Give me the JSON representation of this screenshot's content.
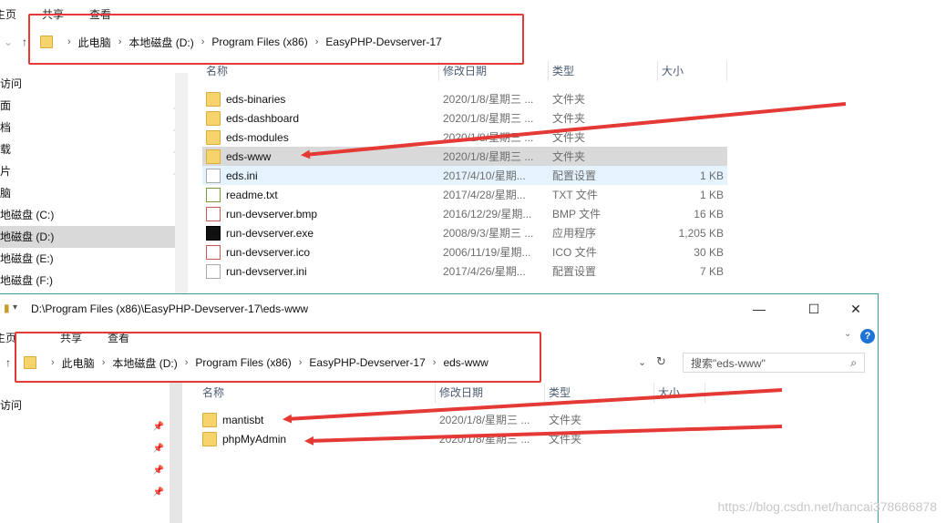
{
  "top": {
    "ribbon": [
      "主页",
      "共享",
      "查看"
    ],
    "breadcrumb": [
      "此电脑",
      "本地磁盘 (D:)",
      "Program Files (x86)",
      "EasyPHP-Devserver-17"
    ],
    "sidebar": [
      "访问",
      "面",
      "档",
      "载",
      "片",
      "脑",
      "地磁盘 (C:)",
      "地磁盘 (D:)",
      "地磁盘 (E:)",
      "地磁盘 (F:)"
    ],
    "columns": {
      "name": "名称",
      "date": "修改日期",
      "type": "类型",
      "size": "大小"
    },
    "files": [
      {
        "name": "eds-binaries",
        "date": "2020/1/8/星期三 ...",
        "type": "文件夹",
        "size": "",
        "icon": "folder-icon"
      },
      {
        "name": "eds-dashboard",
        "date": "2020/1/8/星期三 ...",
        "type": "文件夹",
        "size": "",
        "icon": "folder-icon"
      },
      {
        "name": "eds-modules",
        "date": "2020/1/8/星期三 ...",
        "type": "文件夹",
        "size": "",
        "icon": "folder-icon"
      },
      {
        "name": "eds-www",
        "date": "2020/1/8/星期三 ...",
        "type": "文件夹",
        "size": "",
        "icon": "folder-icon"
      },
      {
        "name": "eds.ini",
        "date": "2017/4/10/星期...",
        "type": "配置设置",
        "size": "1 KB",
        "icon": "ini-file-icon"
      },
      {
        "name": "readme.txt",
        "date": "2017/4/28/星期...",
        "type": "TXT 文件",
        "size": "1 KB",
        "icon": "txt-file-icon"
      },
      {
        "name": "run-devserver.bmp",
        "date": "2016/12/29/星期...",
        "type": "BMP 文件",
        "size": "16 KB",
        "icon": "bmp-file-icon"
      },
      {
        "name": "run-devserver.exe",
        "date": "2008/9/3/星期三 ...",
        "type": "应用程序",
        "size": "1,205 KB",
        "icon": "exe-file-icon"
      },
      {
        "name": "run-devserver.ico",
        "date": "2006/11/19/星期...",
        "type": "ICO 文件",
        "size": "30 KB",
        "icon": "ico-file-icon"
      },
      {
        "name": "run-devserver.ini",
        "date": "2017/4/26/星期...",
        "type": "配置设置",
        "size": "7 KB",
        "icon": "ini-file-icon"
      }
    ]
  },
  "bottom": {
    "title": "D:\\Program Files (x86)\\EasyPHP-Devserver-17\\eds-www",
    "ribbon": [
      "主页",
      "共享",
      "查看"
    ],
    "breadcrumb": [
      "此电脑",
      "本地磁盘 (D:)",
      "Program Files (x86)",
      "EasyPHP-Devserver-17",
      "eds-www"
    ],
    "search_placeholder": "搜索\"eds-www\"",
    "sidebar": [
      "访问"
    ],
    "columns": {
      "name": "名称",
      "date": "修改日期",
      "type": "类型",
      "size": "大小"
    },
    "files": [
      {
        "name": "mantisbt",
        "date": "2020/1/8/星期三 ...",
        "type": "文件夹",
        "icon": "folder-icon"
      },
      {
        "name": "phpMyAdmin",
        "date": "2020/1/8/星期三 ...",
        "type": "文件夹",
        "icon": "folder-icon"
      }
    ]
  },
  "watermark": "https://blog.csdn.net/hancai378686878",
  "colors": {
    "annotation": "#e53935",
    "selection": "#d9d9d9",
    "accent": "#1e73d6"
  }
}
